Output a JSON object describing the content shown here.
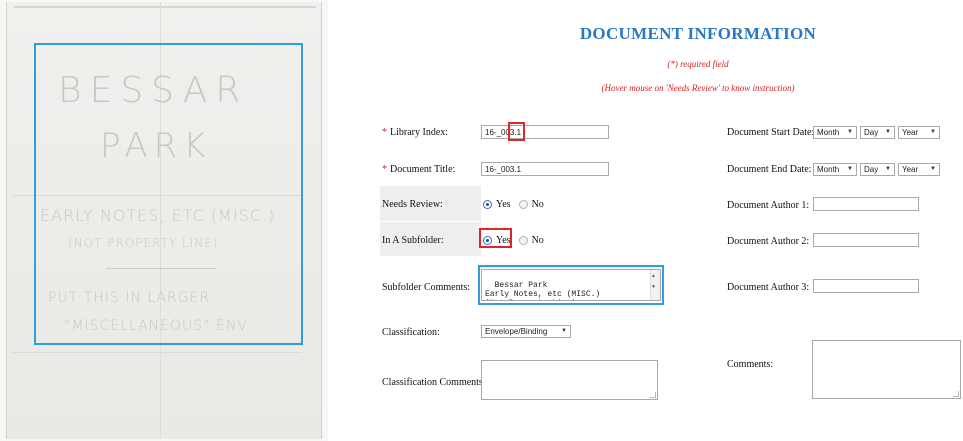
{
  "scan": {
    "line1": "BESSAR",
    "line2": "PARK",
    "line3": "EARLY NOTES, ETC (MISC.)",
    "line4": "(NOT PROPERTY LINE)",
    "line5": "PUT THIS IN LARGER",
    "line6": "\"MISCELLANEOUS\" ENV."
  },
  "form": {
    "title": "DOCUMENT INFORMATION",
    "required_note": "(*) required field",
    "hover_note": "(Hover mouse on 'Needs Review' to know instruction)",
    "required_mark": "*",
    "library_index": {
      "label": "Library Index:",
      "value": "16-_003.1"
    },
    "document_title": {
      "label": "Document Title:",
      "value": "16-_003.1"
    },
    "needs_review": {
      "label": "Needs Review:",
      "yes": "Yes",
      "no": "No",
      "selected": "Yes"
    },
    "in_subfolder": {
      "label": "In A Subfolder:",
      "yes": "Yes",
      "no": "No",
      "selected": "Yes"
    },
    "subfolder_comments": {
      "label": "Subfolder Comments:",
      "value": "Bessar Park\nEarly Notes, etc (MISC.)\n(Not Property Line)"
    },
    "classification": {
      "label": "Classification:",
      "value": "Envelope/Binding"
    },
    "classification_comments": {
      "label": "Classification Comments:",
      "value": ""
    },
    "start_date": {
      "label": "Document Start Date:",
      "month": "Month",
      "day": "Day",
      "year": "Year"
    },
    "end_date": {
      "label": "Document End Date:",
      "month": "Month",
      "day": "Day",
      "year": "Year"
    },
    "author1": {
      "label": "Document Author 1:",
      "value": ""
    },
    "author2": {
      "label": "Document Author 2:",
      "value": ""
    },
    "author3": {
      "label": "Document Author 3:",
      "value": ""
    },
    "comments": {
      "label": "Comments:",
      "value": ""
    }
  },
  "colors": {
    "title": "#2a77c4",
    "note": "#d61f1f",
    "highlight_red": "#e0242c",
    "highlight_blue": "#2f9ee0"
  }
}
